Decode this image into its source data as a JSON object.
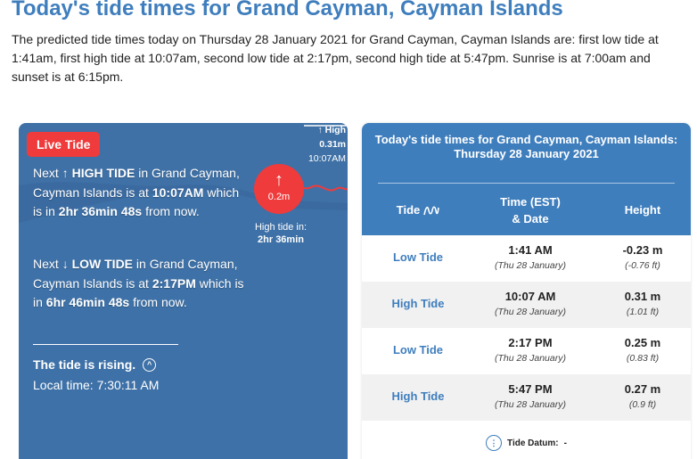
{
  "page": {
    "title": "Today's tide times for Grand Cayman, Cayman Islands",
    "intro": "The predicted tide times today on Thursday 28 January 2021 for Grand Cayman, Cayman Islands are: first low tide at 1:41am, first high tide at 10:07am, second low tide at 2:17pm, second high tide at 5:47pm. Sunrise is at 7:00am and sunset is at 6:15pm."
  },
  "live": {
    "badge": "Live Tide",
    "next_high": {
      "prefix": "Next",
      "arrow": "↑",
      "type": "HIGH TIDE",
      "place": "in Grand Cayman, Cayman Islands is at",
      "time": "10:07AM",
      "which_is_in": "which is in",
      "countdown": "2hr 36min 48s",
      "suffix": "from now."
    },
    "next_low": {
      "prefix": "Next",
      "arrow": "↓",
      "type": "LOW TIDE",
      "place": "in Grand Cayman, Cayman Islands is at",
      "time": "2:17PM",
      "which_is_in": "which is in",
      "countdown": "6hr 46min 48s",
      "suffix": "from now."
    },
    "rising": "The tide is rising.",
    "local_time": "Local time: 7:30:11 AM",
    "marker_arrow": "↑",
    "marker_value": "0.2m",
    "high_in_label": "High tide in:",
    "high_in_value": "2hr 36min",
    "corner_arrow": "↑",
    "corner_label": "High",
    "corner_height": "0.31m",
    "corner_time": "10:07AM",
    "colors": {
      "card": "#3f71a6",
      "accent": "#ef3b3b"
    }
  },
  "table": {
    "title_line1": "Today's tide times for Grand Cayman, Cayman Islands:",
    "title_line2": "Thursday 28 January 2021",
    "col_tide": "Tide",
    "col_tide_icon": "wave-icon",
    "col_time_line1": "Time (EST)",
    "col_time_line2": "& Date",
    "col_height": "Height",
    "rows": [
      {
        "type": "Low Tide",
        "time": "1:41 AM",
        "date": "(Thu 28 January)",
        "height": "-0.23 m",
        "height_ft": "(-0.76 ft)"
      },
      {
        "type": "High Tide",
        "time": "10:07 AM",
        "date": "(Thu 28 January)",
        "height": "0.31 m",
        "height_ft": "(1.01 ft)"
      },
      {
        "type": "Low Tide",
        "time": "2:17 PM",
        "date": "(Thu 28 January)",
        "height": "0.25 m",
        "height_ft": "(0.83 ft)"
      },
      {
        "type": "High Tide",
        "time": "5:47 PM",
        "date": "(Thu 28 January)",
        "height": "0.27 m",
        "height_ft": "(0.9 ft)"
      }
    ],
    "datum_label": "Tide Datum:",
    "datum_value": "-",
    "colors": {
      "header": "#3f7ebd"
    }
  }
}
